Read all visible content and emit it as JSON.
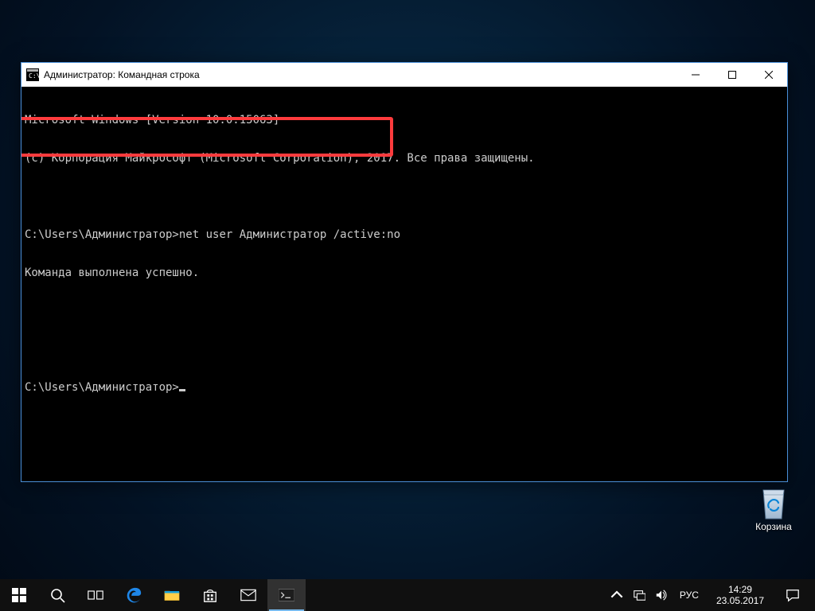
{
  "window": {
    "title": "Администратор: Командная строка"
  },
  "terminal": {
    "line0": "Microsoft Windows [Version 10.0.15063]",
    "line1": "(c) Корпорация Майкрософт (Microsoft Corporation), 2017. Все права защищены.",
    "prompt1": "C:\\Users\\Администратор>",
    "command1": "net user Администратор /active:no",
    "result1": "Команда выполнена успешно.",
    "prompt2": "C:\\Users\\Администратор>"
  },
  "desktop": {
    "recycle_bin": "Корзина"
  },
  "tray": {
    "lang": "РУС",
    "time": "14:29",
    "date": "23.05.2017"
  }
}
